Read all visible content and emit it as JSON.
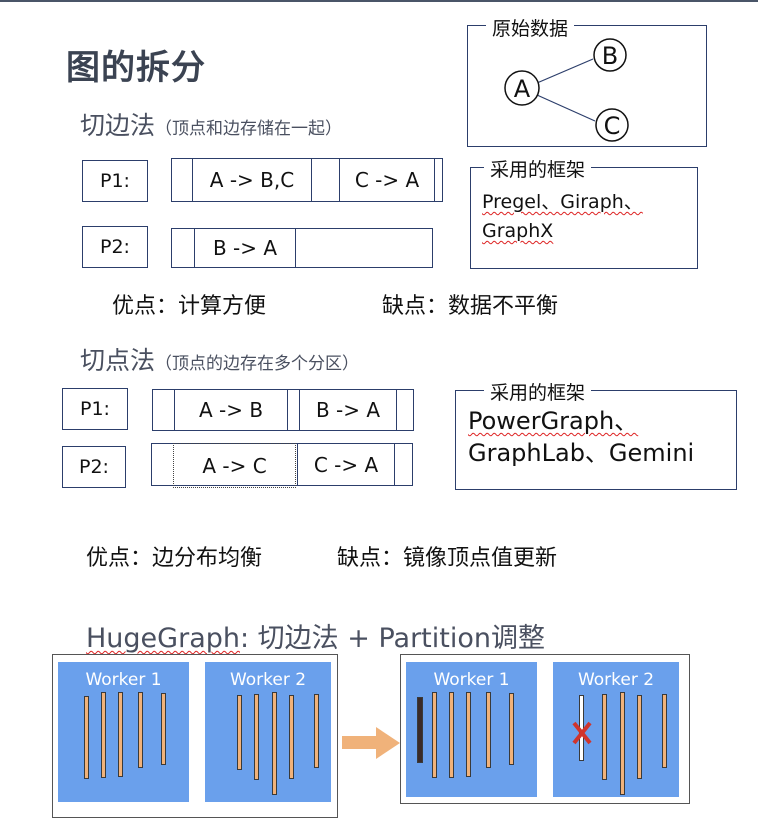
{
  "title": "图的拆分",
  "original": {
    "label": "原始数据",
    "nodes": [
      "A",
      "B",
      "C"
    ]
  },
  "edge_cut": {
    "heading": "切边法",
    "note": "（顶点和边存储在一起）",
    "rows": [
      {
        "label": "P1:",
        "cells": [
          "A -> B,C",
          "C -> A"
        ]
      },
      {
        "label": "P2:",
        "cells": [
          "B -> A"
        ]
      }
    ],
    "framework_label": "采用的框架",
    "frameworks": [
      "Pregel、Giraph、",
      "GraphX"
    ],
    "pros": "优点：计算方便",
    "cons": "缺点：数据不平衡"
  },
  "vertex_cut": {
    "heading": "切点法",
    "note": "（顶点的边存在多个分区）",
    "rows": [
      {
        "label": "P1:",
        "cells": [
          "A -> B",
          "B -> A"
        ]
      },
      {
        "label": "P2:",
        "cells": [
          "A -> C",
          "C -> A"
        ]
      }
    ],
    "framework_label": "采用的框架",
    "frameworks": [
      "PowerGraph、",
      "GraphLab、Gemini"
    ],
    "pros": "优点：边分布均衡",
    "cons": "缺点：镜像顶点值更新"
  },
  "hugegraph": {
    "heading_prefix": "HugeGraph",
    "heading_rest": ": 切边法 + Partition调整",
    "workers": [
      "Worker 1",
      "Worker 2",
      "Worker 1",
      "Worker 2"
    ]
  },
  "colors": {
    "worker_bg": "#6aa0ec",
    "bar_fill": "#f1b27a",
    "arrow": "#f0b27a",
    "cross": "#d0342c",
    "border": "#2c3e6b"
  }
}
